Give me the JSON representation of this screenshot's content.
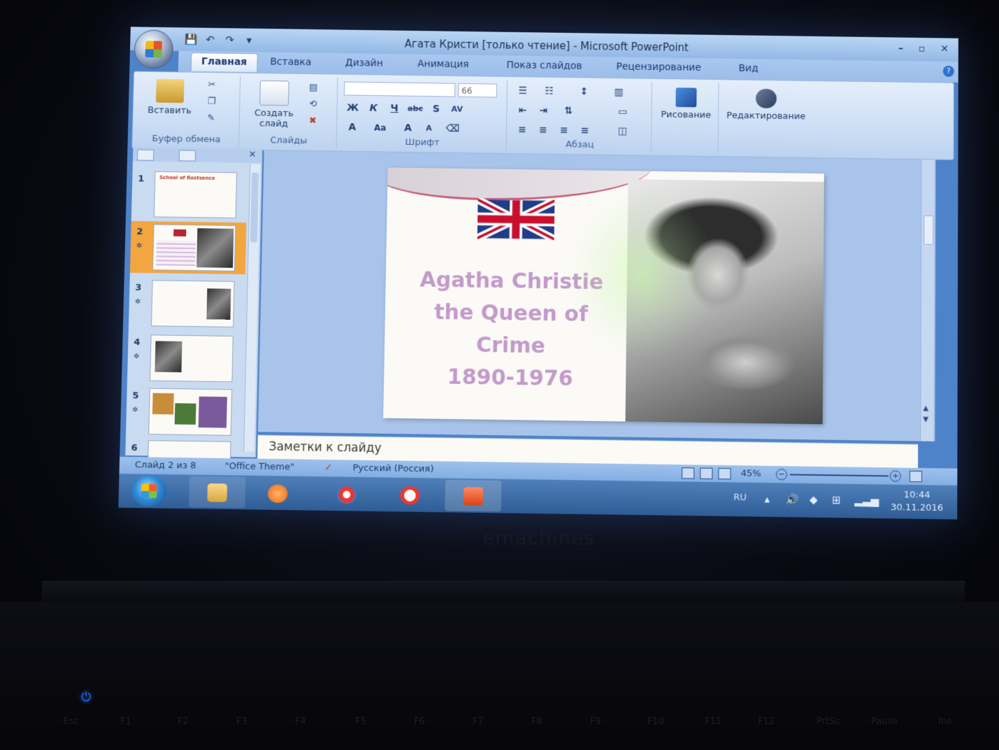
{
  "window": {
    "title": "Агата Кристи [только чтение] - Microsoft PowerPoint",
    "controls": [
      "–",
      "▫",
      "✕"
    ]
  },
  "ribbon_tabs": [
    {
      "label": "Главная",
      "active": true
    },
    {
      "label": "Вставка"
    },
    {
      "label": "Дизайн"
    },
    {
      "label": "Анимация"
    },
    {
      "label": "Показ слайдов"
    },
    {
      "label": "Рецензирование"
    },
    {
      "label": "Вид"
    }
  ],
  "ribbon": {
    "clipboard": {
      "paste_label": "Вставить",
      "group_label": "Буфер обмена"
    },
    "slides": {
      "new_slide_label": "Создать слайд",
      "group_label": "Слайды"
    },
    "font": {
      "font_size": "66",
      "group_label": "Шрифт"
    },
    "paragraph": {
      "group_label": "Абзац"
    },
    "drawing": {
      "label": "Рисование"
    },
    "editing": {
      "label": "Редактирование"
    }
  },
  "thumbnails": [
    {
      "num": "1",
      "title": "School of Rostsence"
    },
    {
      "num": "2",
      "selected": true
    },
    {
      "num": "3"
    },
    {
      "num": "4"
    },
    {
      "num": "5"
    },
    {
      "num": "6"
    }
  ],
  "slide": {
    "lines": [
      "Agatha Christie",
      "the Queen of",
      "Crime",
      "1890-1976"
    ],
    "title_color": "#c39acb"
  },
  "notes": {
    "placeholder": "Заметки к слайду"
  },
  "status": {
    "slide_pos": "Слайд 2 из 8",
    "theme": "\"Office Theme\"",
    "language": "Русский (Россия)",
    "zoom": "45%"
  },
  "taskbar": {
    "lang": "RU",
    "time": "10:44",
    "date": "30.11.2016"
  },
  "laptop": {
    "brand": "emachines",
    "fkeys": [
      "Esc",
      "F1",
      "F2",
      "F3",
      "F4",
      "F5",
      "F6",
      "F7",
      "F8",
      "F9",
      "F10",
      "F11",
      "F12",
      "PrtSc",
      "Pause",
      "Ins"
    ]
  }
}
